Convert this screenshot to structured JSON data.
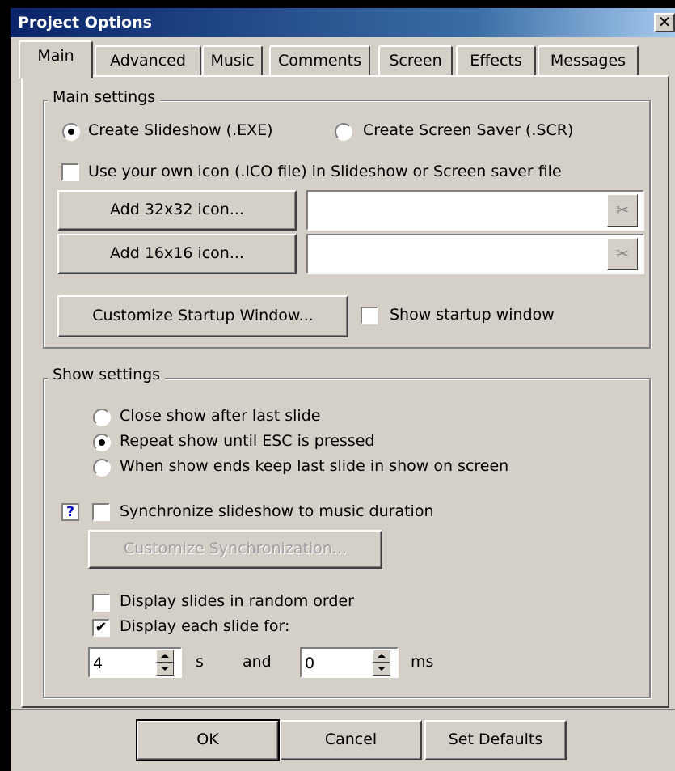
{
  "window": {
    "title": "Project Options",
    "close_glyph": "✕"
  },
  "tabs": [
    "Main",
    "Advanced",
    "Music",
    "Comments",
    "Screen",
    "Effects",
    "Messages"
  ],
  "main_settings": {
    "legend": "Main settings",
    "radio_exe": {
      "label": "Create Slideshow (.EXE)",
      "checked": true
    },
    "radio_scr": {
      "label": "Create Screen Saver (.SCR)",
      "checked": false
    },
    "own_icon": {
      "label": "Use your own icon (.ICO file) in Slideshow or Screen saver file",
      "checked": false
    },
    "add32_label": "Add 32x32 icon...",
    "add32_value": "",
    "add16_label": "Add 16x16 icon...",
    "add16_value": "",
    "clear_glyph": "✂",
    "customize_startup_label": "Customize Startup Window...",
    "show_startup": {
      "label": "Show startup window",
      "checked": false
    }
  },
  "show_settings": {
    "legend": "Show settings",
    "radio_close": {
      "label": "Close show after last slide",
      "checked": false
    },
    "radio_repeat": {
      "label": "Repeat show until ESC is pressed",
      "checked": true
    },
    "radio_keep": {
      "label": "When show ends keep last slide in show on screen",
      "checked": false
    },
    "help_glyph": "?",
    "sync": {
      "label": "Synchronize slideshow to music duration",
      "checked": false
    },
    "customize_sync_label": "Customize Synchronization...",
    "random": {
      "label": "Display slides in random order",
      "checked": false
    },
    "display_each": {
      "label": "Display each slide for:",
      "checked": true,
      "mark": "✔"
    },
    "seconds_value": "4",
    "seconds_unit": "s",
    "and_label": "and",
    "ms_value": "0",
    "ms_unit": "ms"
  },
  "footer": {
    "ok": "OK",
    "cancel": "Cancel",
    "defaults": "Set Defaults"
  },
  "colors": {
    "face": "#d4d0c8",
    "title_start": "#0a246a",
    "title_end": "#a6caf0"
  }
}
